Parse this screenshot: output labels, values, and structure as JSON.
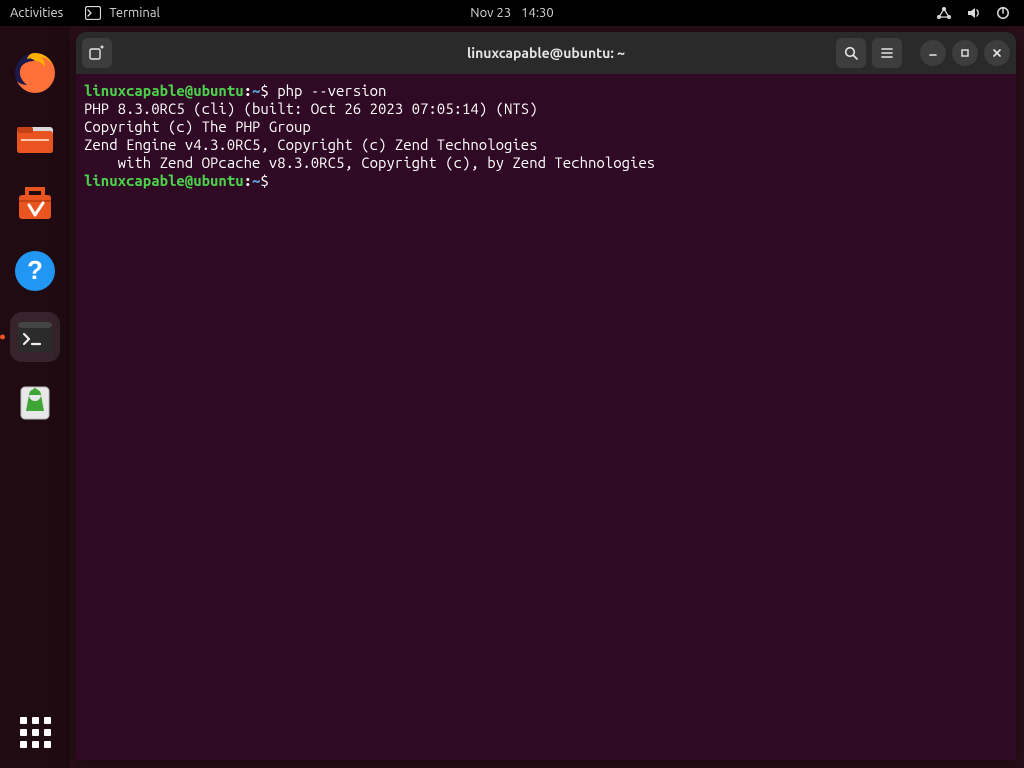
{
  "topbar": {
    "activities": "Activities",
    "app_name": "Terminal",
    "date": "Nov 23",
    "time": "14:30"
  },
  "dock": {
    "items": [
      {
        "name": "firefox"
      },
      {
        "name": "files"
      },
      {
        "name": "software"
      },
      {
        "name": "help"
      },
      {
        "name": "terminal",
        "active": true
      },
      {
        "name": "trash"
      }
    ]
  },
  "window": {
    "title": "linuxcapable@ubuntu: ~"
  },
  "terminal": {
    "prompt_user": "linuxcapable@ubuntu",
    "prompt_sep": ":",
    "prompt_path": "~",
    "prompt_symbol": "$",
    "command1": "php --version",
    "output": [
      "PHP 8.3.0RC5 (cli) (built: Oct 26 2023 07:05:14) (NTS)",
      "Copyright (c) The PHP Group",
      "Zend Engine v4.3.0RC5, Copyright (c) Zend Technologies",
      "    with Zend OPcache v8.3.0RC5, Copyright (c), by Zend Technologies"
    ],
    "command2": ""
  }
}
